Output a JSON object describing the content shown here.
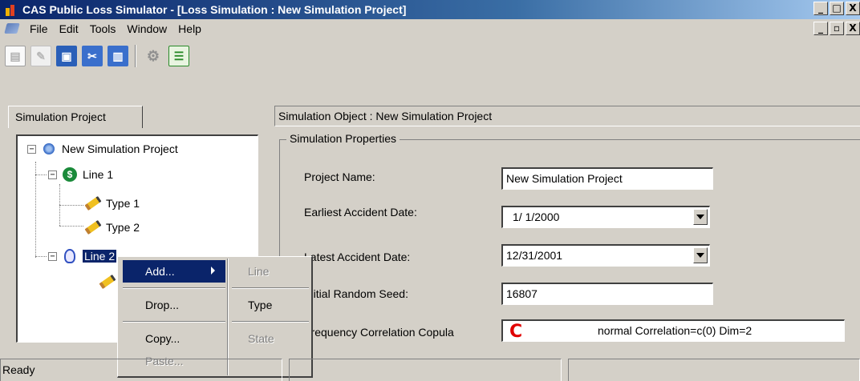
{
  "window": {
    "title": "CAS Public Loss Simulator - [Loss Simulation : New Simulation Project]",
    "controls": [
      "_",
      "□",
      "X"
    ],
    "mdi_controls": [
      "_",
      "▫",
      "X"
    ]
  },
  "menu": {
    "items": [
      "File",
      "Edit",
      "Tools",
      "Window",
      "Help"
    ]
  },
  "toolbar": {
    "buttons": [
      "new-icon",
      "open-icon",
      "save-icon",
      "cut-icon",
      "chart-icon",
      "gear-icon",
      "report-icon"
    ]
  },
  "left_pane": {
    "tab_label": "Simulation Project",
    "tree": {
      "root": "New Simulation Project",
      "line1": "Line 1",
      "type1": "Type 1",
      "type2": "Type 2",
      "line2": "Line 2"
    }
  },
  "right_pane": {
    "header": "Simulation Object : New Simulation Project",
    "group_title": "Simulation Properties",
    "props": {
      "project_name_label": "Project Name:",
      "project_name_value": "New Simulation Project",
      "earliest_label": "Earliest Accident Date:",
      "earliest_value": "1/ 1/2000",
      "latest_label": "Latest Accident Date:",
      "latest_value": "12/31/2001",
      "seed_label": "Initial Random Seed:",
      "seed_value": "16807",
      "copula_label": "Frequency Correlation Copula",
      "copula_value": "normal Correlation=c(0) Dim=2"
    }
  },
  "context_menu": {
    "add": "Add...",
    "drop": "Drop...",
    "copy": "Copy...",
    "paste": "Paste...",
    "submenu": {
      "line": "Line",
      "type": "Type",
      "state": "State"
    }
  },
  "statusbar": {
    "text": "Ready"
  },
  "colors": {
    "title_start": "#0a246a",
    "selection": "#0a246a",
    "face": "#d4d0c8"
  }
}
